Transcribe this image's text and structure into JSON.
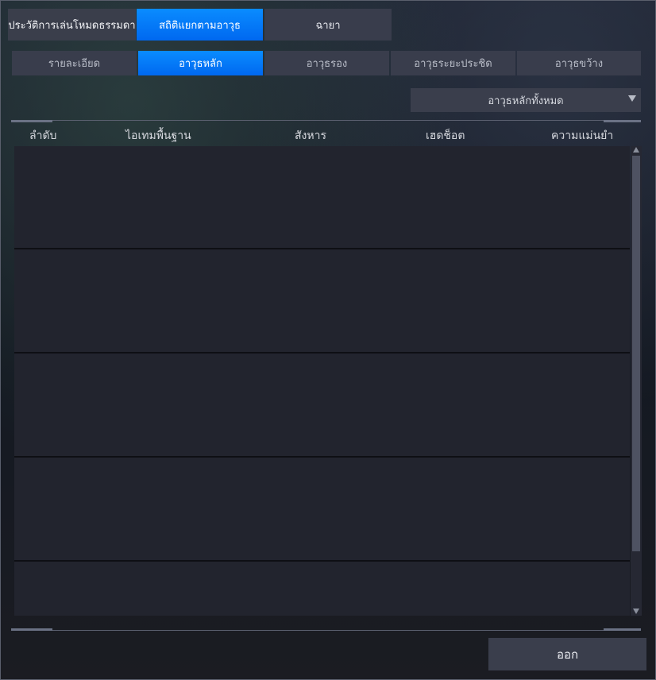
{
  "header": {
    "mode_label": "ประวัติการเล่นโหมดธรรมดา",
    "tabs": [
      {
        "label": "สถิติแยกตามอาวุธ",
        "active": true
      },
      {
        "label": "ฉายา",
        "active": false
      }
    ]
  },
  "subtabs": [
    {
      "label": "รายละเอียด",
      "active": false
    },
    {
      "label": "อาวุธหลัก",
      "active": true
    },
    {
      "label": "อาวุธรอง",
      "active": false
    },
    {
      "label": "อาวุธระยะประชิด",
      "active": false
    },
    {
      "label": "อาวุธขว้าง",
      "active": false
    }
  ],
  "filter": {
    "selected": "อาวุธหลักทั้งหมด",
    "icon": "dropdown-arrow-icon"
  },
  "table": {
    "columns": [
      "ลำดับ",
      "ไอเทมพื้นฐาน",
      "สังหาร",
      "เฮดช็อต",
      "ความแม่นยำ"
    ],
    "rows": [
      [],
      [],
      [],
      [],
      []
    ]
  },
  "footer": {
    "exit_label": "ออก"
  },
  "colors": {
    "accent": "#0a84ff",
    "panel": "#3a3e4c",
    "table": "#22242e"
  }
}
